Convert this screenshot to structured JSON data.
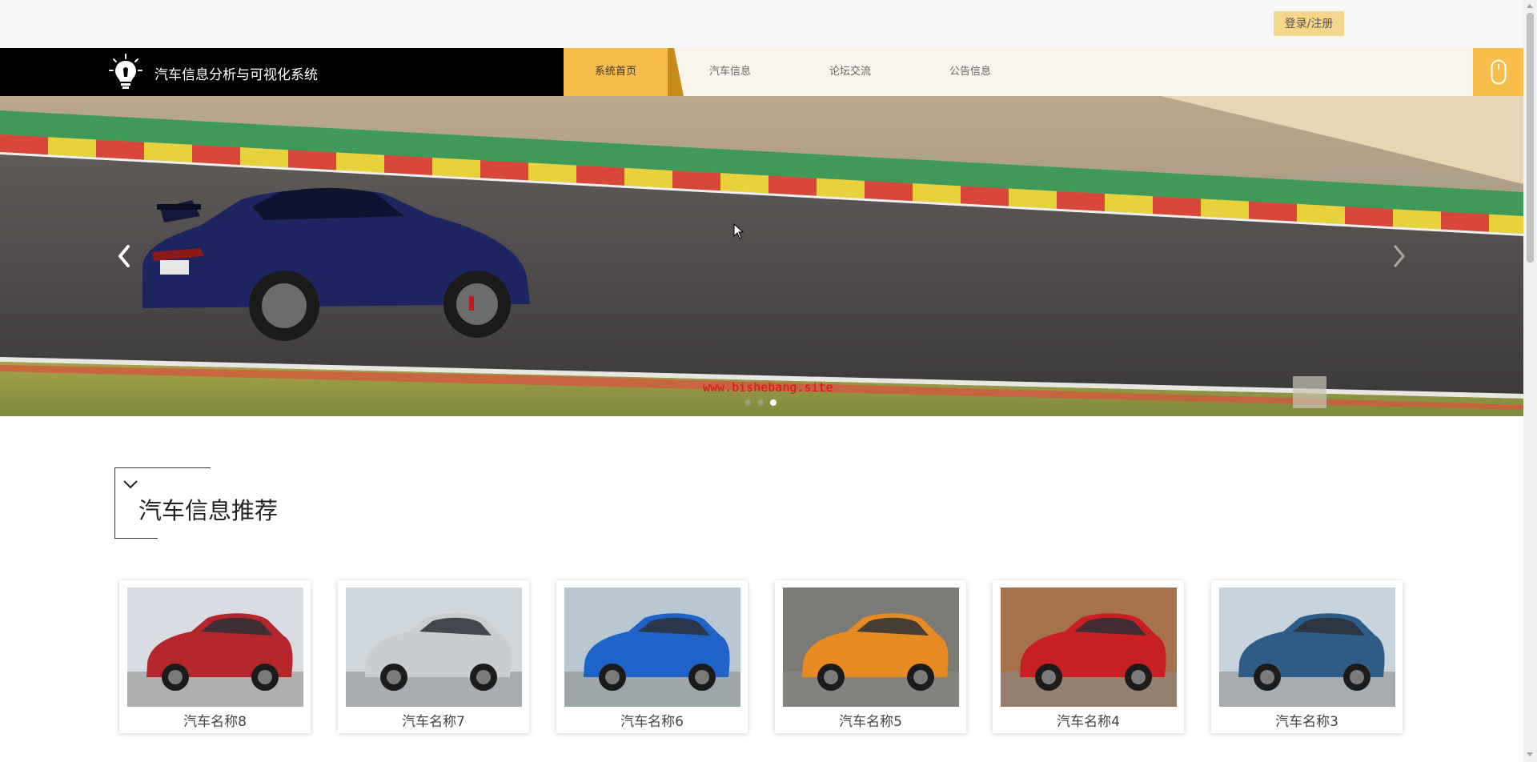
{
  "header": {
    "login_label": "登录/注册"
  },
  "nav": {
    "brand_title": "汽车信息分析与可视化系统",
    "items": [
      {
        "label": "系统首页",
        "active": true
      },
      {
        "label": "汽车信息",
        "active": false
      },
      {
        "label": "论坛交流",
        "active": false
      },
      {
        "label": "公告信息",
        "active": false
      }
    ],
    "accent_color": "#f8bd4a",
    "side_icon": "mouse-icon"
  },
  "banner": {
    "watermark": "www.bishebang.site",
    "slides_count": 3,
    "active_slide": 3,
    "prev_icon": "chevron-left-icon",
    "next_icon": "chevron-right-icon"
  },
  "section": {
    "title": "汽车信息推荐",
    "icon": "chevron-down-icon"
  },
  "cars": [
    {
      "name": "汽车名称8",
      "color": "#b5262c"
    },
    {
      "name": "汽车名称7",
      "color": "#c9cdd2"
    },
    {
      "name": "汽车名称6",
      "color": "#1f63c9"
    },
    {
      "name": "汽车名称5",
      "color": "#e88a22"
    },
    {
      "name": "汽车名称4",
      "color": "#c81e24"
    },
    {
      "name": "汽车名称3",
      "color": "#2f5c86"
    }
  ]
}
